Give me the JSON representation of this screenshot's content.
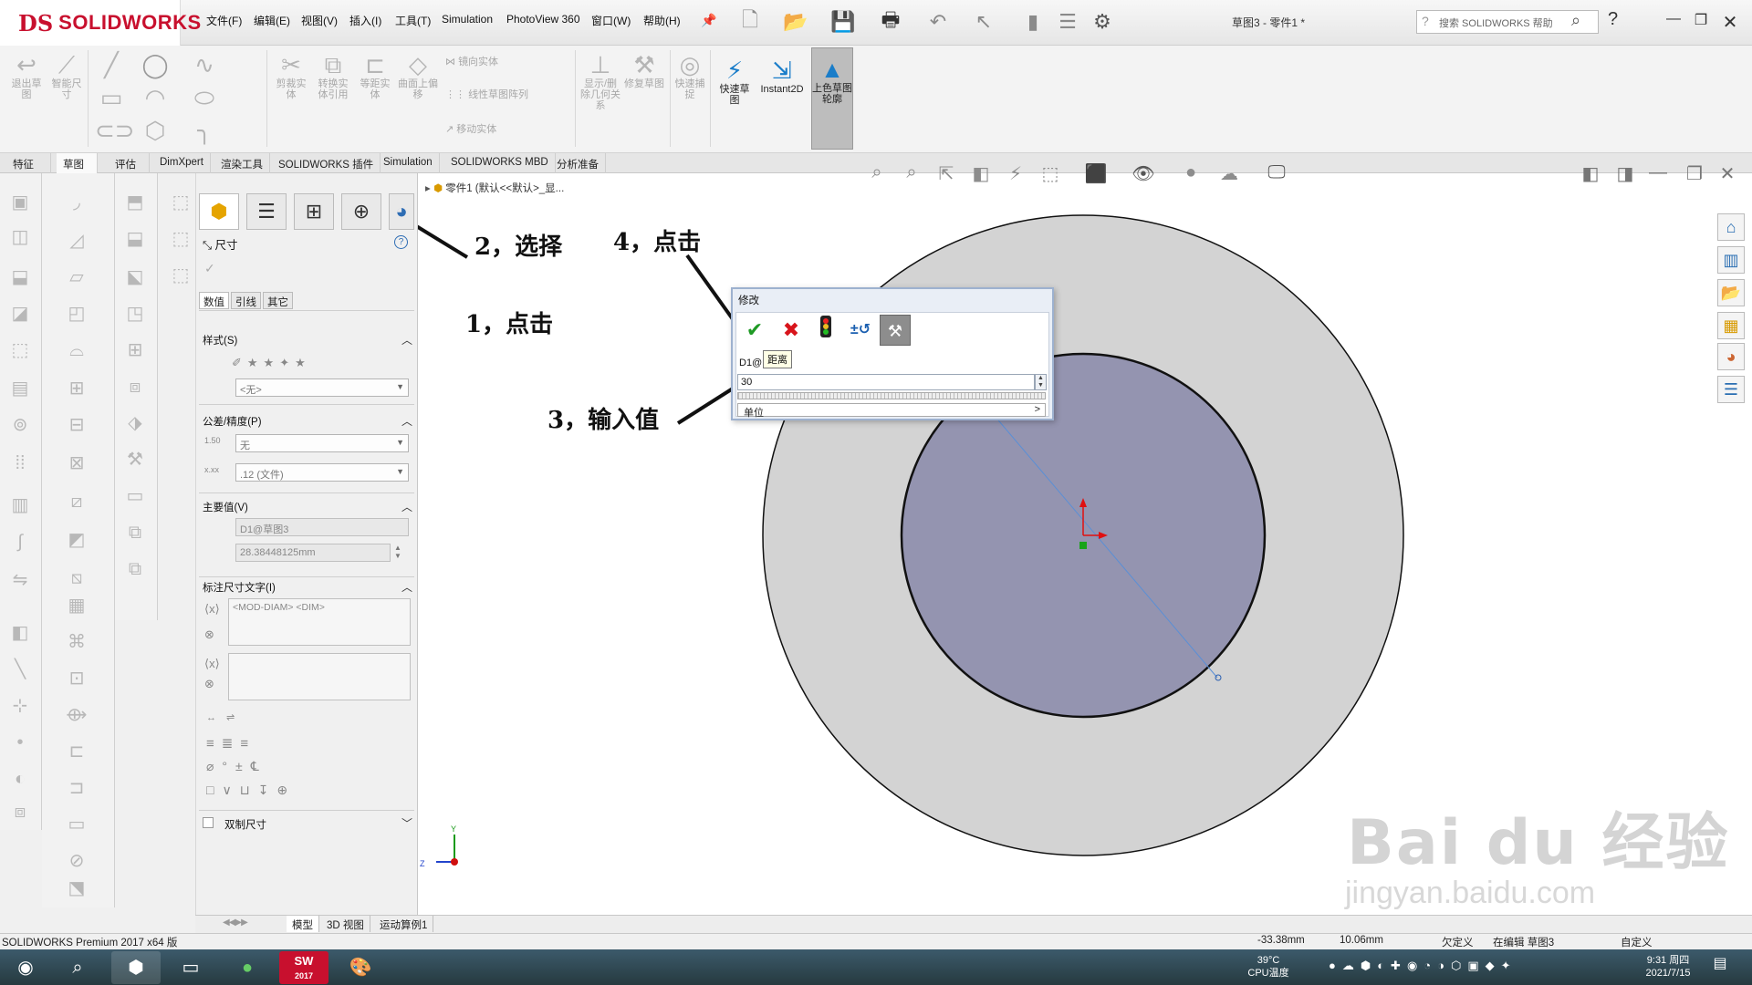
{
  "window": {
    "brand": "SOLIDWORKS",
    "logo_mark": "DS",
    "doc_title": "草图3 - 零件1 *",
    "search_placeholder": "搜索 SOLIDWORKS 帮助"
  },
  "menu": [
    "文件(F)",
    "编辑(E)",
    "视图(V)",
    "插入(I)",
    "工具(T)",
    "Simulation",
    "PhotoView 360",
    "窗口(W)",
    "帮助(H)"
  ],
  "ribbon": {
    "exit_sketch": "退出草图",
    "smart_dim": "智能尺寸",
    "trim": "剪裁实体",
    "convert": "转换实体引用",
    "offset": "等距实体",
    "surface_offset": "曲面上偏移",
    "mirror": "镜向实体",
    "linear_pattern": "线性草图阵列",
    "move": "移动实体",
    "display_delete": "显示/删除几何关系",
    "repair": "修复草图",
    "quick_snap": "快速捕捉",
    "rapid_sketch": "快速草图",
    "instant2d": "Instant2D",
    "shaded_contours": "上色草图轮廓"
  },
  "command_tabs": [
    "特征",
    "草图",
    "评估",
    "DimXpert",
    "渲染工具",
    "SOLIDWORKS 插件",
    "Simulation",
    "SOLIDWORKS MBD",
    "分析准备"
  ],
  "property_manager": {
    "title": "尺寸",
    "help": "?",
    "subtabs": [
      "数值",
      "引线",
      "其它"
    ],
    "style_group": "样式(S)",
    "style_value": "<无>",
    "tolerance_group": "公差/精度(P)",
    "tolerance_value": "无",
    "precision_value": ".12 (文件)",
    "primary_group": "主要值(V)",
    "primary_name": "D1@草图3",
    "primary_value": "28.38448125mm",
    "dimtext_group": "标注尺寸文字(I)",
    "dimtext_value": "<MOD-DIAM> <DIM>",
    "dual_dim": "双制尺寸"
  },
  "viewport": {
    "breadcrumb": "零件1 (默认<<默认>_显..."
  },
  "modify_dialog": {
    "title": "修改",
    "name": "D1@",
    "tooltip": "距离",
    "value": "30",
    "units": "单位"
  },
  "annotations": {
    "step1": "1，点击",
    "step2": "2，选择",
    "step3": "3，输入值",
    "step4": "4，点击"
  },
  "bottom_tabs": [
    "模型",
    "3D 视图",
    "运动算例1"
  ],
  "status": {
    "product": "SOLIDWORKS Premium 2017 x64 版",
    "x": "-33.38mm",
    "y": "10.06mm",
    "defined": "欠定义",
    "editing": "在编辑 草图3",
    "custom": "自定义"
  },
  "taskbar": {
    "temp": "39°C",
    "temp_label": "CPU温度",
    "time": "9:31 周四",
    "date": "2021/7/15",
    "sw_label": "2017"
  },
  "watermark": {
    "text": "Bai du 经验",
    "url": "jingyan.baidu.com"
  },
  "colors": {
    "brand": "#c8102e",
    "outer_disk": "#d3d3d3",
    "inner_disk": "#9494b0",
    "ok": "#1f9a25",
    "cancel": "#d8141b"
  }
}
